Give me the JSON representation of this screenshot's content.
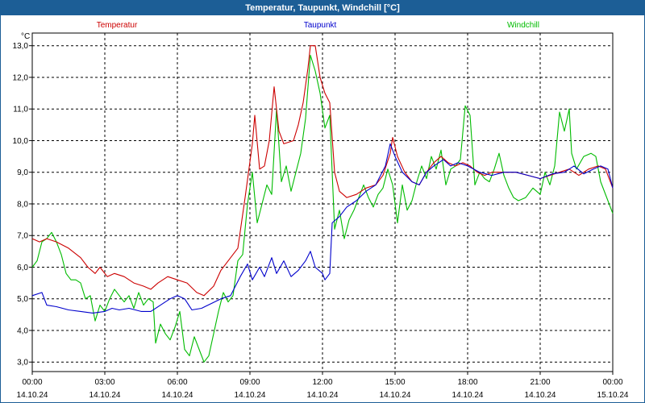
{
  "window": {
    "title": "Temperatur, Taupunkt, Windchill [°C]"
  },
  "chart_data": {
    "type": "line",
    "title": "Temperatur, Taupunkt, Windchill [°C]",
    "ylabel": "°C",
    "ylim": [
      2.7,
      13.4
    ],
    "xlim": [
      0,
      24
    ],
    "grid": true,
    "legend_position": "top",
    "y_ticks": [
      "3,0",
      "4,0",
      "5,0",
      "6,0",
      "7,0",
      "8,0",
      "9,0",
      "10,0",
      "11,0",
      "12,0",
      "13,0"
    ],
    "x_ticks": [
      {
        "time": "00:00",
        "date": "14.10.24"
      },
      {
        "time": "03:00",
        "date": "14.10.24"
      },
      {
        "time": "06:00",
        "date": "14.10.24"
      },
      {
        "time": "09:00",
        "date": "14.10.24"
      },
      {
        "time": "12:00",
        "date": "14.10.24"
      },
      {
        "time": "15:00",
        "date": "14.10.24"
      },
      {
        "time": "18:00",
        "date": "14.10.24"
      },
      {
        "time": "21:00",
        "date": "14.10.24"
      },
      {
        "time": "00:00",
        "date": "15.10.24"
      }
    ],
    "series": [
      {
        "name": "Temperatur",
        "color": "#cc0000",
        "points": [
          [
            0,
            6.9
          ],
          [
            0.3,
            6.8
          ],
          [
            0.6,
            6.9
          ],
          [
            1.0,
            6.8
          ],
          [
            1.5,
            6.6
          ],
          [
            2.0,
            6.3
          ],
          [
            2.3,
            6.0
          ],
          [
            2.6,
            5.8
          ],
          [
            2.8,
            6.0
          ],
          [
            3.1,
            5.7
          ],
          [
            3.4,
            5.8
          ],
          [
            3.8,
            5.7
          ],
          [
            4.2,
            5.5
          ],
          [
            4.6,
            5.4
          ],
          [
            4.9,
            5.3
          ],
          [
            5.2,
            5.5
          ],
          [
            5.6,
            5.7
          ],
          [
            6.0,
            5.6
          ],
          [
            6.4,
            5.5
          ],
          [
            6.8,
            5.2
          ],
          [
            7.1,
            5.1
          ],
          [
            7.5,
            5.4
          ],
          [
            7.8,
            5.9
          ],
          [
            8.2,
            6.3
          ],
          [
            8.5,
            6.6
          ],
          [
            8.8,
            8.2
          ],
          [
            9.1,
            9.9
          ],
          [
            9.2,
            10.8
          ],
          [
            9.4,
            9.1
          ],
          [
            9.6,
            9.2
          ],
          [
            9.8,
            10.0
          ],
          [
            10.0,
            11.7
          ],
          [
            10.2,
            10.3
          ],
          [
            10.4,
            9.9
          ],
          [
            10.8,
            10.0
          ],
          [
            11.0,
            10.5
          ],
          [
            11.2,
            11.2
          ],
          [
            11.4,
            12.3
          ],
          [
            11.5,
            13.0
          ],
          [
            11.7,
            13.0
          ],
          [
            11.9,
            12.0
          ],
          [
            12.1,
            11.5
          ],
          [
            12.3,
            11.2
          ],
          [
            12.5,
            9.0
          ],
          [
            12.7,
            8.4
          ],
          [
            13.0,
            8.2
          ],
          [
            13.4,
            8.3
          ],
          [
            13.8,
            8.5
          ],
          [
            14.2,
            8.6
          ],
          [
            14.5,
            8.9
          ],
          [
            14.8,
            9.6
          ],
          [
            14.9,
            10.1
          ],
          [
            15.1,
            9.5
          ],
          [
            15.4,
            9.0
          ],
          [
            15.7,
            8.7
          ],
          [
            16.0,
            8.6
          ],
          [
            16.3,
            9.0
          ],
          [
            16.6,
            9.3
          ],
          [
            16.9,
            9.5
          ],
          [
            17.2,
            9.3
          ],
          [
            17.5,
            9.2
          ],
          [
            17.8,
            9.3
          ],
          [
            18.1,
            9.2
          ],
          [
            18.4,
            9.0
          ],
          [
            18.7,
            8.9
          ],
          [
            19.0,
            9.0
          ],
          [
            19.5,
            9.0
          ],
          [
            20.0,
            9.0
          ],
          [
            20.5,
            8.9
          ],
          [
            21.0,
            8.8
          ],
          [
            21.4,
            8.9
          ],
          [
            21.8,
            9.0
          ],
          [
            22.2,
            9.1
          ],
          [
            22.6,
            8.9
          ],
          [
            23.0,
            9.1
          ],
          [
            23.4,
            9.2
          ],
          [
            23.7,
            9.1
          ],
          [
            24.0,
            8.5
          ]
        ]
      },
      {
        "name": "Taupunkt",
        "color": "#0000cc",
        "points": [
          [
            0,
            5.1
          ],
          [
            0.4,
            5.2
          ],
          [
            0.6,
            4.8
          ],
          [
            1.0,
            4.75
          ],
          [
            1.5,
            4.65
          ],
          [
            2.0,
            4.6
          ],
          [
            2.5,
            4.55
          ],
          [
            3.0,
            4.6
          ],
          [
            3.3,
            4.7
          ],
          [
            3.6,
            4.65
          ],
          [
            4.0,
            4.7
          ],
          [
            4.5,
            4.6
          ],
          [
            4.9,
            4.6
          ],
          [
            5.3,
            4.8
          ],
          [
            5.7,
            5.0
          ],
          [
            6.0,
            5.1
          ],
          [
            6.3,
            5.0
          ],
          [
            6.6,
            4.65
          ],
          [
            7.0,
            4.7
          ],
          [
            7.4,
            4.85
          ],
          [
            7.8,
            5.0
          ],
          [
            8.2,
            5.1
          ],
          [
            8.6,
            5.7
          ],
          [
            8.9,
            6.1
          ],
          [
            9.1,
            5.6
          ],
          [
            9.4,
            6.0
          ],
          [
            9.6,
            5.7
          ],
          [
            9.9,
            6.3
          ],
          [
            10.1,
            5.8
          ],
          [
            10.4,
            6.2
          ],
          [
            10.7,
            5.7
          ],
          [
            11.0,
            5.9
          ],
          [
            11.3,
            6.2
          ],
          [
            11.5,
            6.5
          ],
          [
            11.7,
            6.0
          ],
          [
            12.0,
            5.8
          ],
          [
            12.1,
            5.6
          ],
          [
            12.3,
            5.8
          ],
          [
            12.4,
            7.4
          ],
          [
            12.7,
            7.6
          ],
          [
            13.0,
            7.9
          ],
          [
            13.4,
            8.1
          ],
          [
            13.8,
            8.4
          ],
          [
            14.2,
            8.6
          ],
          [
            14.6,
            9.2
          ],
          [
            14.8,
            9.9
          ],
          [
            15.0,
            9.5
          ],
          [
            15.3,
            9.0
          ],
          [
            15.7,
            8.7
          ],
          [
            16.0,
            8.6
          ],
          [
            16.3,
            9.0
          ],
          [
            16.6,
            9.2
          ],
          [
            17.0,
            9.4
          ],
          [
            17.3,
            9.2
          ],
          [
            17.6,
            9.3
          ],
          [
            18.0,
            9.2
          ],
          [
            18.5,
            9.0
          ],
          [
            19.0,
            8.9
          ],
          [
            19.5,
            9.0
          ],
          [
            20.0,
            9.0
          ],
          [
            20.5,
            8.9
          ],
          [
            21.0,
            8.8
          ],
          [
            21.5,
            8.95
          ],
          [
            22.0,
            9.0
          ],
          [
            22.4,
            9.2
          ],
          [
            22.8,
            8.95
          ],
          [
            23.2,
            9.1
          ],
          [
            23.5,
            9.2
          ],
          [
            23.8,
            9.1
          ],
          [
            24.0,
            8.5
          ]
        ]
      },
      {
        "name": "Windchill",
        "color": "#00bb00",
        "points": [
          [
            0,
            6.0
          ],
          [
            0.2,
            6.2
          ],
          [
            0.4,
            6.8
          ],
          [
            0.6,
            6.9
          ],
          [
            0.8,
            7.1
          ],
          [
            1.0,
            6.8
          ],
          [
            1.2,
            6.4
          ],
          [
            1.4,
            5.8
          ],
          [
            1.6,
            5.6
          ],
          [
            1.8,
            5.6
          ],
          [
            2.0,
            5.5
          ],
          [
            2.2,
            5.0
          ],
          [
            2.4,
            5.1
          ],
          [
            2.6,
            4.3
          ],
          [
            2.8,
            4.8
          ],
          [
            3.0,
            4.6
          ],
          [
            3.2,
            5.0
          ],
          [
            3.4,
            5.3
          ],
          [
            3.6,
            5.1
          ],
          [
            3.8,
            4.9
          ],
          [
            4.0,
            5.1
          ],
          [
            4.2,
            4.7
          ],
          [
            4.4,
            5.2
          ],
          [
            4.6,
            4.8
          ],
          [
            4.8,
            5.0
          ],
          [
            5.0,
            4.9
          ],
          [
            5.1,
            3.6
          ],
          [
            5.3,
            4.2
          ],
          [
            5.5,
            3.9
          ],
          [
            5.7,
            3.7
          ],
          [
            5.9,
            4.1
          ],
          [
            6.1,
            4.6
          ],
          [
            6.3,
            3.4
          ],
          [
            6.5,
            3.2
          ],
          [
            6.7,
            3.8
          ],
          [
            6.9,
            3.4
          ],
          [
            7.1,
            3.0
          ],
          [
            7.3,
            3.2
          ],
          [
            7.5,
            3.9
          ],
          [
            7.7,
            4.6
          ],
          [
            7.9,
            5.2
          ],
          [
            8.1,
            4.9
          ],
          [
            8.3,
            5.1
          ],
          [
            8.5,
            6.2
          ],
          [
            8.7,
            6.4
          ],
          [
            8.9,
            8.0
          ],
          [
            9.1,
            9.0
          ],
          [
            9.3,
            7.4
          ],
          [
            9.5,
            8.0
          ],
          [
            9.7,
            8.6
          ],
          [
            9.9,
            8.3
          ],
          [
            10.1,
            11.0
          ],
          [
            10.3,
            8.7
          ],
          [
            10.5,
            9.2
          ],
          [
            10.7,
            8.4
          ],
          [
            10.9,
            9.0
          ],
          [
            11.1,
            9.6
          ],
          [
            11.3,
            10.7
          ],
          [
            11.5,
            12.7
          ],
          [
            11.7,
            12.2
          ],
          [
            11.9,
            11.5
          ],
          [
            12.1,
            10.4
          ],
          [
            12.3,
            10.8
          ],
          [
            12.5,
            7.2
          ],
          [
            12.7,
            7.8
          ],
          [
            12.9,
            6.9
          ],
          [
            13.1,
            7.5
          ],
          [
            13.3,
            7.8
          ],
          [
            13.5,
            8.2
          ],
          [
            13.7,
            8.6
          ],
          [
            13.9,
            8.2
          ],
          [
            14.1,
            7.9
          ],
          [
            14.3,
            8.3
          ],
          [
            14.5,
            8.5
          ],
          [
            14.7,
            9.1
          ],
          [
            14.9,
            8.6
          ],
          [
            15.1,
            7.4
          ],
          [
            15.3,
            8.6
          ],
          [
            15.5,
            7.8
          ],
          [
            15.7,
            8.1
          ],
          [
            15.9,
            8.7
          ],
          [
            16.1,
            9.2
          ],
          [
            16.3,
            8.8
          ],
          [
            16.5,
            9.5
          ],
          [
            16.7,
            9.1
          ],
          [
            16.9,
            9.7
          ],
          [
            17.1,
            8.6
          ],
          [
            17.3,
            9.1
          ],
          [
            17.5,
            9.2
          ],
          [
            17.7,
            9.4
          ],
          [
            17.9,
            11.1
          ],
          [
            18.1,
            10.8
          ],
          [
            18.3,
            8.6
          ],
          [
            18.5,
            9.0
          ],
          [
            18.7,
            8.8
          ],
          [
            18.9,
            8.7
          ],
          [
            19.1,
            9.1
          ],
          [
            19.3,
            9.6
          ],
          [
            19.5,
            8.9
          ],
          [
            19.7,
            8.5
          ],
          [
            19.9,
            8.2
          ],
          [
            20.1,
            8.1
          ],
          [
            20.4,
            8.2
          ],
          [
            20.7,
            8.5
          ],
          [
            21.0,
            8.3
          ],
          [
            21.2,
            9.0
          ],
          [
            21.4,
            8.6
          ],
          [
            21.6,
            9.2
          ],
          [
            21.8,
            10.9
          ],
          [
            22.0,
            10.3
          ],
          [
            22.2,
            11.0
          ],
          [
            22.3,
            9.6
          ],
          [
            22.5,
            9.1
          ],
          [
            22.8,
            9.5
          ],
          [
            23.1,
            9.6
          ],
          [
            23.3,
            9.5
          ],
          [
            23.5,
            8.7
          ],
          [
            23.8,
            8.1
          ],
          [
            24.0,
            7.7
          ]
        ]
      }
    ]
  }
}
